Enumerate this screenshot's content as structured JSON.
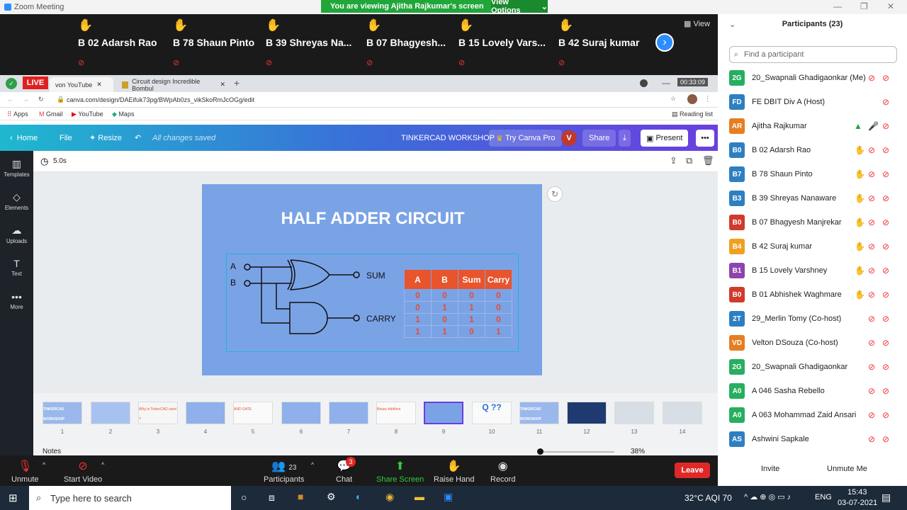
{
  "window": {
    "title": "Zoom Meeting"
  },
  "banner": {
    "message": "You are viewing Ajitha Rajkumar's screen",
    "view_options": "View Options"
  },
  "video_tiles": [
    {
      "name": "B 02 Adarsh Rao"
    },
    {
      "name": "B 78 Shaun Pinto"
    },
    {
      "name": "B 39 Shreyas Na..."
    },
    {
      "name": "B 07 Bhagyesh..."
    },
    {
      "name": "B 15 Lovely Vars..."
    },
    {
      "name": "B 42 Suraj kumar"
    }
  ],
  "view_label": "View",
  "browser": {
    "live": "LIVE",
    "tabs": [
      "von YouTube",
      "Circuit design Incredible Bombul"
    ],
    "timer": "00:33:09",
    "url": "canva.com/design/DAEifuk73pg/BWpAb0zs_vikSkoRmJcOGg/edit",
    "bookmarks": [
      "Apps",
      "Gmail",
      "YouTube",
      "Maps"
    ],
    "reading_list": "Reading list"
  },
  "canva": {
    "home": "Home",
    "file": "File",
    "resize": "Resize",
    "saved": "All changes saved",
    "project": "TINKERCAD WORKSHOP",
    "try_pro": "Try Canva Pro",
    "avatar": "V",
    "share": "Share",
    "present": "Present",
    "sidebar": [
      "Templates",
      "Elements",
      "Uploads",
      "Text",
      "More"
    ],
    "timing": "5.0s",
    "notes": "Notes",
    "zoom": "38%",
    "slide": {
      "title": "HALF ADDER CIRCUIT",
      "inputs": [
        "A",
        "B"
      ],
      "outputs": [
        "SUM",
        "CARRY"
      ],
      "table_headers": [
        "A",
        "B",
        "Sum",
        "Carry"
      ],
      "table_rows": [
        [
          "0",
          "0",
          "0",
          "0"
        ],
        [
          "0",
          "1",
          "1",
          "0"
        ],
        [
          "1",
          "0",
          "1",
          "0"
        ],
        [
          "1",
          "1",
          "0",
          "1"
        ]
      ]
    },
    "page_numbers": [
      "1",
      "2",
      "3",
      "4",
      "5",
      "6",
      "7",
      "8",
      "9",
      "10",
      "11",
      "12",
      "13",
      "14"
    ],
    "thumb_titles": [
      "TINKERCAD WORKSHOP",
      "",
      "Why is TinkerCAD used ?",
      "",
      "AND GATE",
      "",
      "",
      "Binary Addition",
      "",
      "Q ??",
      "TINKERCAD WORKSHOP",
      "",
      "",
      ""
    ]
  },
  "zoom_toolbar": {
    "unmute": "Unmute",
    "start_video": "Start Video",
    "participants": "Participants",
    "participants_count": "23",
    "chat": "Chat",
    "chat_badge": "3",
    "share_screen": "Share Screen",
    "raise_hand": "Raise Hand",
    "record": "Record",
    "leave": "Leave"
  },
  "participants_panel": {
    "title": "Participants (23)",
    "search_placeholder": "Find a participant",
    "invite": "Invite",
    "unmute_me": "Unmute Me",
    "list": [
      {
        "initials": "2G",
        "name": "20_Swapnali Ghadigaonkar (Me)",
        "color": "#27ae60"
      },
      {
        "initials": "FD",
        "name": "FE DBIT Div A (Host)",
        "color": "#2d7fc1"
      },
      {
        "initials": "AR",
        "name": "Ajitha Rajkumar",
        "color": "#e67e22"
      },
      {
        "initials": "B0",
        "name": "B 02 Adarsh Rao",
        "color": "#2d7fc1"
      },
      {
        "initials": "B7",
        "name": "B 78 Shaun Pinto",
        "color": "#2d7fc1"
      },
      {
        "initials": "B3",
        "name": "B 39 Shreyas Nanaware",
        "color": "#2d7fc1"
      },
      {
        "initials": "B0",
        "name": "B 07 Bhagyesh Manjrekar",
        "color": "#d03b2c"
      },
      {
        "initials": "B4",
        "name": "B 42 Suraj kumar",
        "color": "#f0a020"
      },
      {
        "initials": "B1",
        "name": "B 15 Lovely Varshney",
        "color": "#8e44ad"
      },
      {
        "initials": "B0",
        "name": "B 01 Abhishek Waghmare",
        "color": "#d03b2c"
      },
      {
        "initials": "2T",
        "name": "29_Merlin Tomy (Co-host)",
        "color": "#2d7fc1"
      },
      {
        "initials": "VD",
        "name": "Velton DSouza (Co-host)",
        "color": "#e67e22"
      },
      {
        "initials": "2G",
        "name": "20_Swapnali Ghadigaonkar",
        "color": "#27ae60"
      },
      {
        "initials": "A0",
        "name": "A 046 Sasha Rebello",
        "color": "#27ae60"
      },
      {
        "initials": "A0",
        "name": "A 063 Mohammad Zaid Ansari",
        "color": "#27ae60"
      },
      {
        "initials": "AS",
        "name": "Ashwini Sapkale",
        "color": "#2d7fc1"
      }
    ]
  },
  "taskbar": {
    "search_placeholder": "Type here to search",
    "weather": "32°C AQI 70",
    "lang": "ENG",
    "time": "15:43",
    "date": "03-07-2021"
  }
}
